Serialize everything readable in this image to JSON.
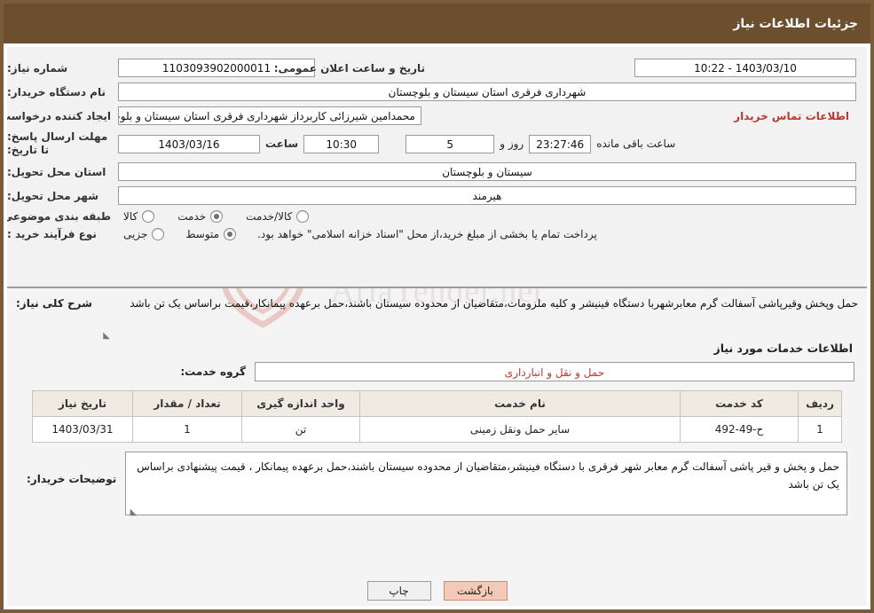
{
  "header": {
    "title": "جزئیات اطلاعات نیاز"
  },
  "info": {
    "need_number_label": "شماره نیاز:",
    "need_number_value": "1103093902000011",
    "announce_datetime_label": "تاریخ و ساعت اعلان عمومی:",
    "announce_datetime_value": "1403/03/10 - 10:22",
    "buyer_org_label": "نام دستگاه خریدار:",
    "buyer_org_value": "شهرداری فرقری استان سیستان و بلوچستان",
    "requester_label": "ایجاد کننده درخواست:",
    "requester_value": "محمدامین شیرزائی کاربرداز شهرداری فرقری استان سیستان و بلوچستان",
    "contact_link": "اطلاعات تماس خریدار",
    "deadline_label": "مهلت ارسال پاسخ: تا تاریخ:",
    "deadline_date": "1403/03/16",
    "hour_label": "ساعت",
    "deadline_hour": "10:30",
    "remaining_days": "5",
    "remaining_days_label": "روز و",
    "remaining_time": "23:27:46",
    "remaining_suffix": "ساعت باقی مانده",
    "province_label": "استان محل تحویل:",
    "province_value": "سیستان و بلوچستان",
    "city_label": "شهر محل تحویل:",
    "city_value": "هیرمند",
    "category_label": "طبقه بندی موضوعی:",
    "category_options": [
      "کالا",
      "خدمت",
      "کالا/خدمت"
    ],
    "category_selected": "خدمت",
    "purchase_type_label": "نوع فرآیند خرید :",
    "purchase_type_options": [
      "جزیی",
      "متوسط"
    ],
    "purchase_type_selected": "متوسط",
    "purchase_note": "پرداخت تمام یا بخشی از مبلغ خرید،از محل \"اسناد خزانه اسلامی\" خواهد بود."
  },
  "description": {
    "label": "شرح کلی نیاز:",
    "text": "حمل وپخش وقیرپاشی آسفالت گرم معابرشهربا دستگاه فینیشر و کلیه ملزومات،متقاضیان از محدوده سیستان باشند،حمل برعهده پیمانکار،قیمت براساس یک تن باشد"
  },
  "services": {
    "section_title": "اطلاعات خدمات مورد نیاز",
    "group_label": "گروه خدمت:",
    "group_value": "حمل و نقل و انبارداری",
    "columns": [
      "ردیف",
      "کد خدمت",
      "نام خدمت",
      "واحد اندازه گیری",
      "تعداد / مقدار",
      "تاریخ نیاز"
    ],
    "rows": [
      {
        "row": "1",
        "code": "ح-49-492",
        "name": "سایر حمل ونقل زمینی",
        "unit": "تن",
        "qty": "1",
        "date": "1403/03/31"
      }
    ]
  },
  "buyer_notes": {
    "label": "توضیحات خریدار:",
    "text": "حمل و پخش و قیر پاشی آسفالت گرم معابر شهر فرقری با دستگاه فینیشر،متقاضیان از محدوده سیستان باشند،حمل برعهده پیمانکار ، قیمت پیشنهادی براساس یک تن باشد"
  },
  "footer": {
    "print_label": "چاپ",
    "back_label": "بازگشت"
  },
  "watermark": {
    "text": "AriaTender.net"
  }
}
